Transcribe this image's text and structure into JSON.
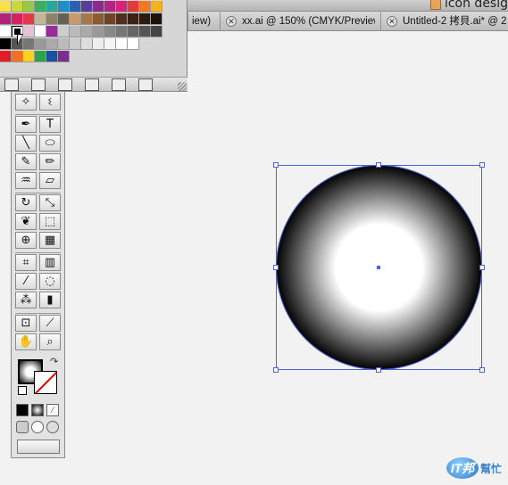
{
  "window": {
    "app_title": "icon desig"
  },
  "tabs": [
    {
      "label": "iew)",
      "closable": false
    },
    {
      "label": "xx.ai @ 150% (CMYK/Preview)",
      "closable": true
    },
    {
      "label": "Untitled-2 拷貝.ai* @ 2",
      "closable": true
    }
  ],
  "swatches": {
    "rows": [
      [
        "#fde047",
        "#c9d93b",
        "#97c84a",
        "#3dae5f",
        "#2aa79b",
        "#1b8fc8",
        "#2a5fb4",
        "#5a3c9c",
        "#8a2c8e",
        "#b32582",
        "#d9237a",
        "#e63a3a",
        "#f07a24",
        "#f6b21d"
      ],
      [
        "#b1237b",
        "#d71f63",
        "#e8364b",
        "#c1b59a",
        "#8b826a",
        "#676155",
        "#c79b6b",
        "#a7774a",
        "#8d5b33",
        "#6e4326",
        "#4f2f1c",
        "#3a2314",
        "#2b1a10",
        "#1e130b"
      ],
      [
        "#ffffff",
        "#000000",
        "#e7c0d9",
        "#ffffff",
        "#9a2b9e",
        "#cccccc",
        "#bbbbbb",
        "#aaaaaa",
        "#999999",
        "#888888",
        "#777777",
        "#666666",
        "#555555",
        "#444444"
      ],
      [
        "#000000",
        "#555555",
        "#777777",
        "#999999",
        "#aaaaaa",
        "#bbbbbb",
        "#cccccc",
        "#dddddd",
        "#eeeeee",
        "#f5f5f5",
        "#ffffff",
        "#ffffff"
      ],
      [
        "#e31b23",
        "#f36f21",
        "#fdd21f",
        "#2ba24c",
        "#1d4fa3",
        "#7a2e8e"
      ]
    ]
  },
  "artwork": {
    "shape": "circle",
    "fill": "radial-gradient",
    "gradient_stops": [
      "#ffffff",
      "#ffffff",
      "#000000"
    ],
    "selection_color": "#4a63d8"
  },
  "watermark": {
    "badge": "IT邦",
    "text": "幫忙"
  }
}
